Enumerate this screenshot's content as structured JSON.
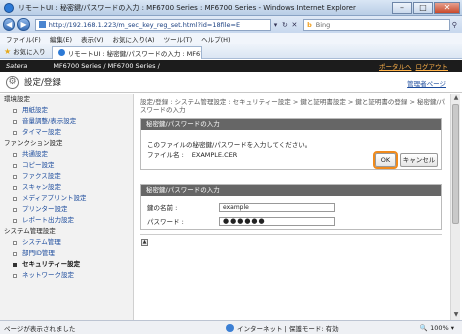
{
  "window": {
    "title": "リモートUI : 秘密鍵/パスワードの入力 : MF6700 Series : MF6700 Series - Windows Internet Explorer",
    "controls": {
      "minimize": "–",
      "maximize": "□",
      "close": "✕"
    }
  },
  "address_bar": {
    "url": "http://192.168.1.223/m_sec_key_reg_set.html?id=18file=E",
    "search_engine": "Bing"
  },
  "menu": [
    "ファイル(F)",
    "編集(E)",
    "表示(V)",
    "お気に入り(A)",
    "ツール(T)",
    "ヘルプ(H)"
  ],
  "favorites_bar": {
    "favorites_label": "お気に入り",
    "tab_label": "リモートUI : 秘密鍵/パスワードの入力 : MF67..."
  },
  "page_header": {
    "brand": "Satera",
    "model": "MF6700 Series / MF6700 Series /",
    "portal_link": "ポータルへ",
    "logout_link": "ログアウト"
  },
  "section": {
    "title": "設定/登録",
    "manual_link": "管理者ページ"
  },
  "sidebar": {
    "groups": [
      {
        "header": "環境設定",
        "items": [
          "用紙設定",
          "音量調整/表示設定",
          "タイマー設定"
        ]
      },
      {
        "header": "ファンクション設定",
        "items": [
          "共通設定",
          "コピー設定",
          "ファクス設定",
          "スキャン設定",
          "メディアプリント設定",
          "プリンター設定",
          "レポート出力設定"
        ]
      },
      {
        "header": "システム管理設定",
        "items": [
          "システム管理",
          "部門ID管理",
          "セキュリティー設定",
          "ネットワーク設定"
        ]
      }
    ],
    "active_item": "セキュリティー設定"
  },
  "main": {
    "breadcrumb": "設定/登録 : システム管理設定 : セキュリティー設定 > 鍵と証明書設定 > 鍵と証明書の登録 > 秘密鍵/パスワードの入力",
    "dialog": {
      "header": "秘密鍵/パスワードの入力",
      "message": "このファイルの秘密鍵/パスワードを入力してください。",
      "file_label": "ファイル名 :",
      "file_name": "EXAMPLE.CER",
      "ok_label": "OK",
      "cancel_label": "キャンセル"
    },
    "form": {
      "header": "秘密鍵/パスワードの入力",
      "key_name_label": "鍵の名前 :",
      "key_name_value": "example",
      "password_label": "パスワード :",
      "password_value": "●●●●●●"
    }
  },
  "status_bar": {
    "left": "ページが表示されました",
    "zone": "インターネット | 保護モード: 有効",
    "zoom": "100%"
  }
}
